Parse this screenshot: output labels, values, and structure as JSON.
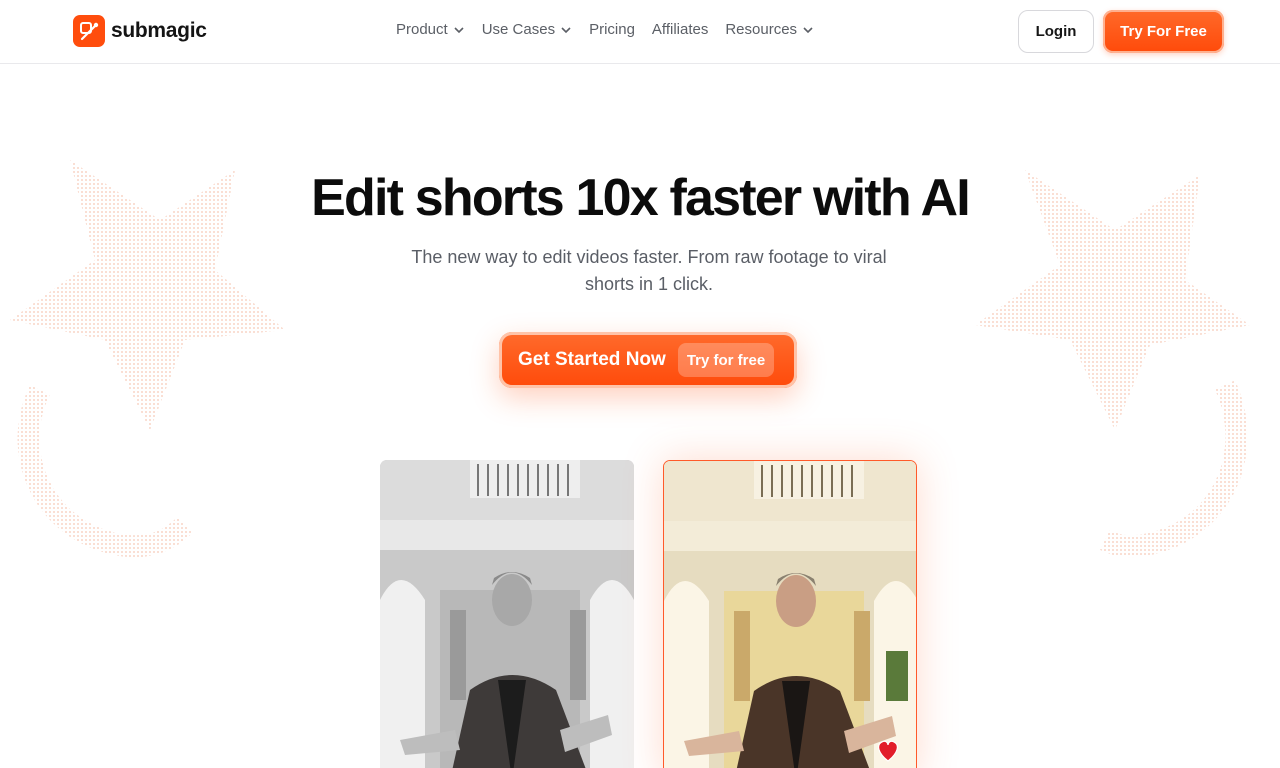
{
  "header": {
    "logo_text": "submagic",
    "nav": [
      {
        "label": "Product",
        "has_dropdown": true
      },
      {
        "label": "Use Cases",
        "has_dropdown": true
      },
      {
        "label": "Pricing",
        "has_dropdown": false
      },
      {
        "label": "Affiliates",
        "has_dropdown": false
      },
      {
        "label": "Resources",
        "has_dropdown": true
      }
    ],
    "login_label": "Login",
    "try_label": "Try For Free"
  },
  "hero": {
    "title": "Edit shorts 10x faster with AI",
    "subtitle": "The new way to edit videos faster. From raw footage to viral shorts in 1 click.",
    "cta_label": "Get Started Now",
    "cta_badge": "Try for free"
  },
  "colors": {
    "accent": "#ff4d0d",
    "text_dark": "#0c0c0c",
    "text_muted": "#5a5e66"
  },
  "icons": [
    "logo-icon",
    "chevron-down-icon",
    "heart-icon"
  ]
}
